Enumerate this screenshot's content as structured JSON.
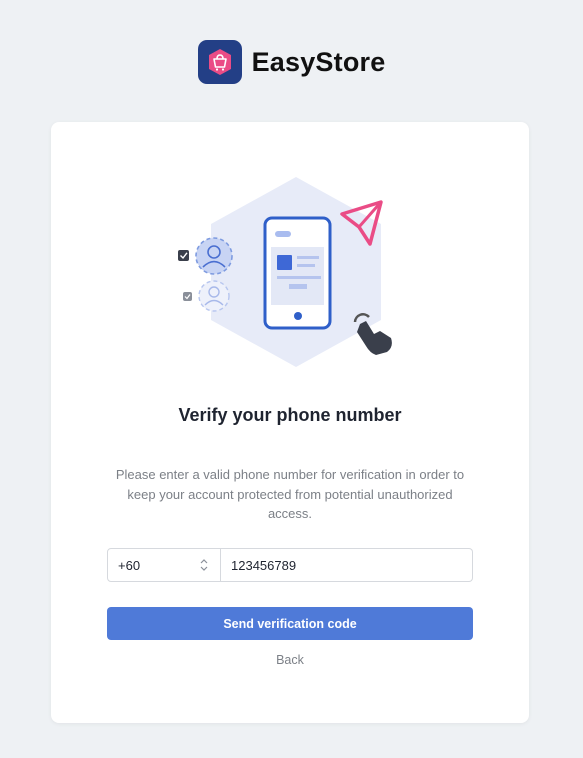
{
  "brand": {
    "name": "EasyStore",
    "logo_icon": "shopping-bag-icon",
    "logo_bg": "#233f86",
    "logo_accent": "#ea4c86"
  },
  "page": {
    "title": "Verify your phone number",
    "description": "Please enter a valid phone number for verification in order to keep your account protected from potential unauthorized access."
  },
  "form": {
    "country_code": "+60",
    "phone_number": "123456789",
    "send_button_label": "Send verification code",
    "back_label": "Back"
  },
  "colors": {
    "primary": "#4f7ad8",
    "background": "#eef1f4"
  }
}
